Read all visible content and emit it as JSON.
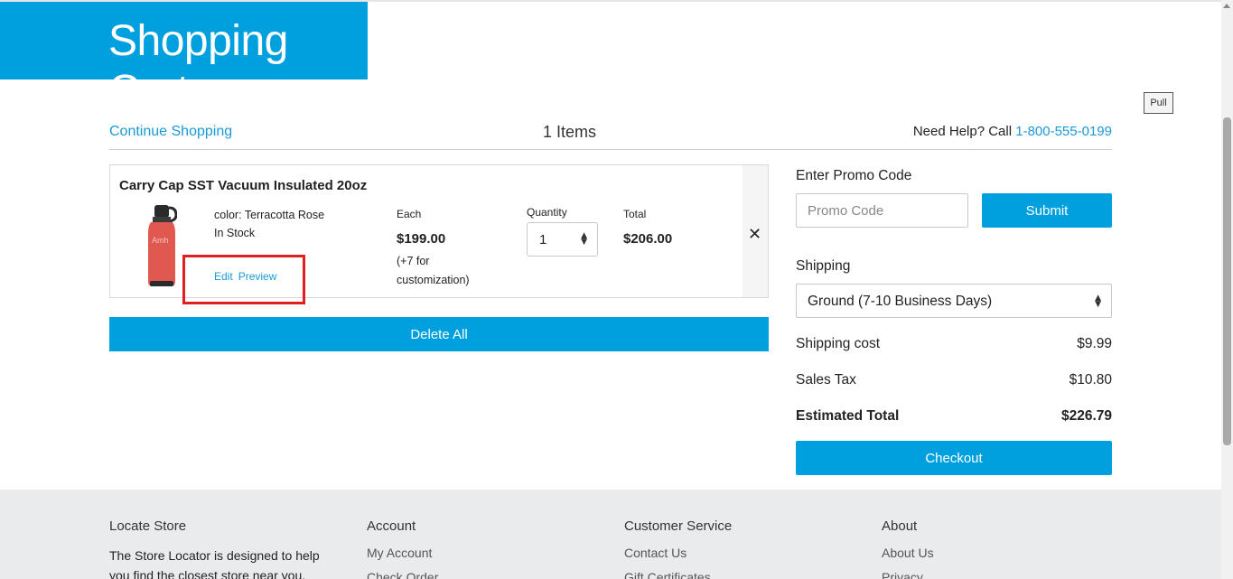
{
  "header": {
    "title": "Shopping Cart",
    "pull_label": "Pull"
  },
  "nav": {
    "continue_label": "Continue Shopping",
    "items_count": "1 Items",
    "help_prefix": "Need Help? Call ",
    "help_phone": "1-800-555-0199"
  },
  "cart": {
    "item": {
      "name": "Carry Cap SST Vacuum Insulated 20oz",
      "color": "color: Terracotta Rose",
      "stock": "In Stock",
      "edit_label": "Edit",
      "preview_label": "Preview",
      "each_label": "Each",
      "each_price": "$199.00",
      "each_note": "(+7 for customization)",
      "quantity_label": "Quantity",
      "quantity_value": "1",
      "total_label": "Total",
      "total_price": "$206.00",
      "bottle_text": "Amh",
      "bottle_color": "#e0584f"
    },
    "delete_all_label": "Delete All"
  },
  "sidebar": {
    "promo_label": "Enter Promo Code",
    "promo_placeholder": "Promo Code",
    "submit_label": "Submit",
    "shipping_label": "Shipping",
    "shipping_option": "Ground (7-10 Business Days)",
    "shipping_cost_label": "Shipping cost",
    "shipping_cost": "$9.99",
    "sales_tax_label": "Sales Tax",
    "sales_tax": "$10.80",
    "estimated_total_label": "Estimated Total",
    "estimated_total": "$226.79",
    "checkout_label": "Checkout"
  },
  "footer": {
    "locate_store": {
      "heading": "Locate Store",
      "text": "The Store Locator is designed to help you find the closest store near you."
    },
    "account": {
      "heading": "Account",
      "links": [
        "My Account",
        "Check Order"
      ]
    },
    "customer_service": {
      "heading": "Customer Service",
      "links": [
        "Contact Us",
        "Gift Certificates"
      ]
    },
    "about": {
      "heading": "About",
      "links": [
        "About Us",
        "Privacy"
      ]
    }
  },
  "colors": {
    "accent": "#00a0df",
    "link": "#1a9ad6",
    "highlight": "#e02020",
    "footer_bg": "#e9ebed"
  }
}
